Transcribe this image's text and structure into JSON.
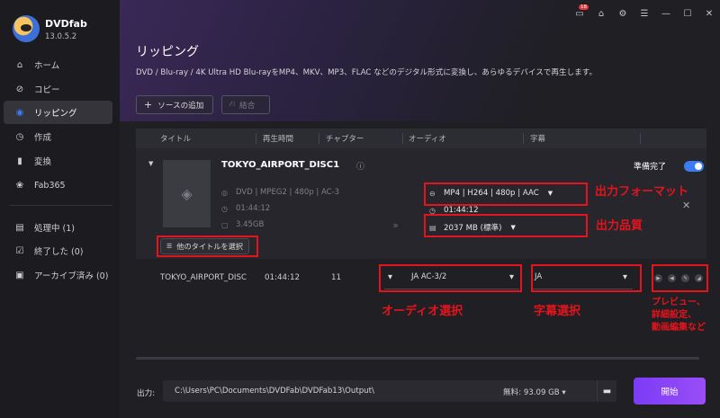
{
  "app": {
    "name": "DVDfab",
    "version": "13.0.5.2"
  },
  "titlebar": {
    "notification_count": "18"
  },
  "sidebar": {
    "items": [
      {
        "label": "ホーム",
        "icon": "home-icon"
      },
      {
        "label": "コピー",
        "icon": "copy-icon"
      },
      {
        "label": "リッピング",
        "icon": "ripper-icon",
        "active": true
      },
      {
        "label": "作成",
        "icon": "creator-icon"
      },
      {
        "label": "変換",
        "icon": "converter-icon"
      },
      {
        "label": "Fab365",
        "icon": "fab365-icon"
      }
    ],
    "queue": [
      {
        "label": "処理中 (1)",
        "icon": "processing-icon"
      },
      {
        "label": "終了した (0)",
        "icon": "finished-icon"
      },
      {
        "label": "アーカイブ済み (0)",
        "icon": "archive-icon"
      }
    ]
  },
  "header": {
    "title": "リッピング",
    "description": "DVD / Blu-ray / 4K Ultra HD Blu-rayをMP4、MKV、MP3、FLAC などのデジタル形式に変換し、あらゆるデバイスで再生します。",
    "add_source": "ソースの追加",
    "merge": "結合"
  },
  "table": {
    "columns": [
      "タイトル",
      "再生時間",
      "チャプター",
      "オーディオ",
      "字幕"
    ],
    "disc": {
      "title": "TOKYO_AIRPORT_DISC1",
      "format_info": "DVD | MPEG2 | 480p | AC-3",
      "duration": "01:44:12",
      "size": "3.45GB",
      "select_other_title": "他のタイトルを選択",
      "output_format": "MP4 | H264 | 480p | AAC",
      "output_duration": "01:44:12",
      "output_size": "2037 MB (標準)",
      "status": "準備完了",
      "ready_toggle": true
    },
    "track": {
      "title": "TOKYO_AIRPORT_DISC",
      "duration": "01:44:12",
      "chapters": "11",
      "audio": "JA  AC-3/2",
      "subtitle": "JA"
    }
  },
  "annotations": {
    "output_format": "出力フォーマット",
    "output_quality": "出力品質",
    "audio_select": "オーディオ選択",
    "subtitle_select": "字幕選択",
    "preview": "プレビュー、\n詳細設定、\n動画編集など",
    "color": "#e5141c"
  },
  "footer": {
    "output_label": "出力:",
    "path": "C:\\Users\\PC\\Documents\\DVDFab\\DVDFab13\\Output\\",
    "free_space": "無料: 93.09 GB ▾",
    "start": "開始"
  },
  "colors": {
    "accent": "#3a7cf2",
    "start_button": "#8a44f6",
    "annotation_red": "#e5141c"
  }
}
